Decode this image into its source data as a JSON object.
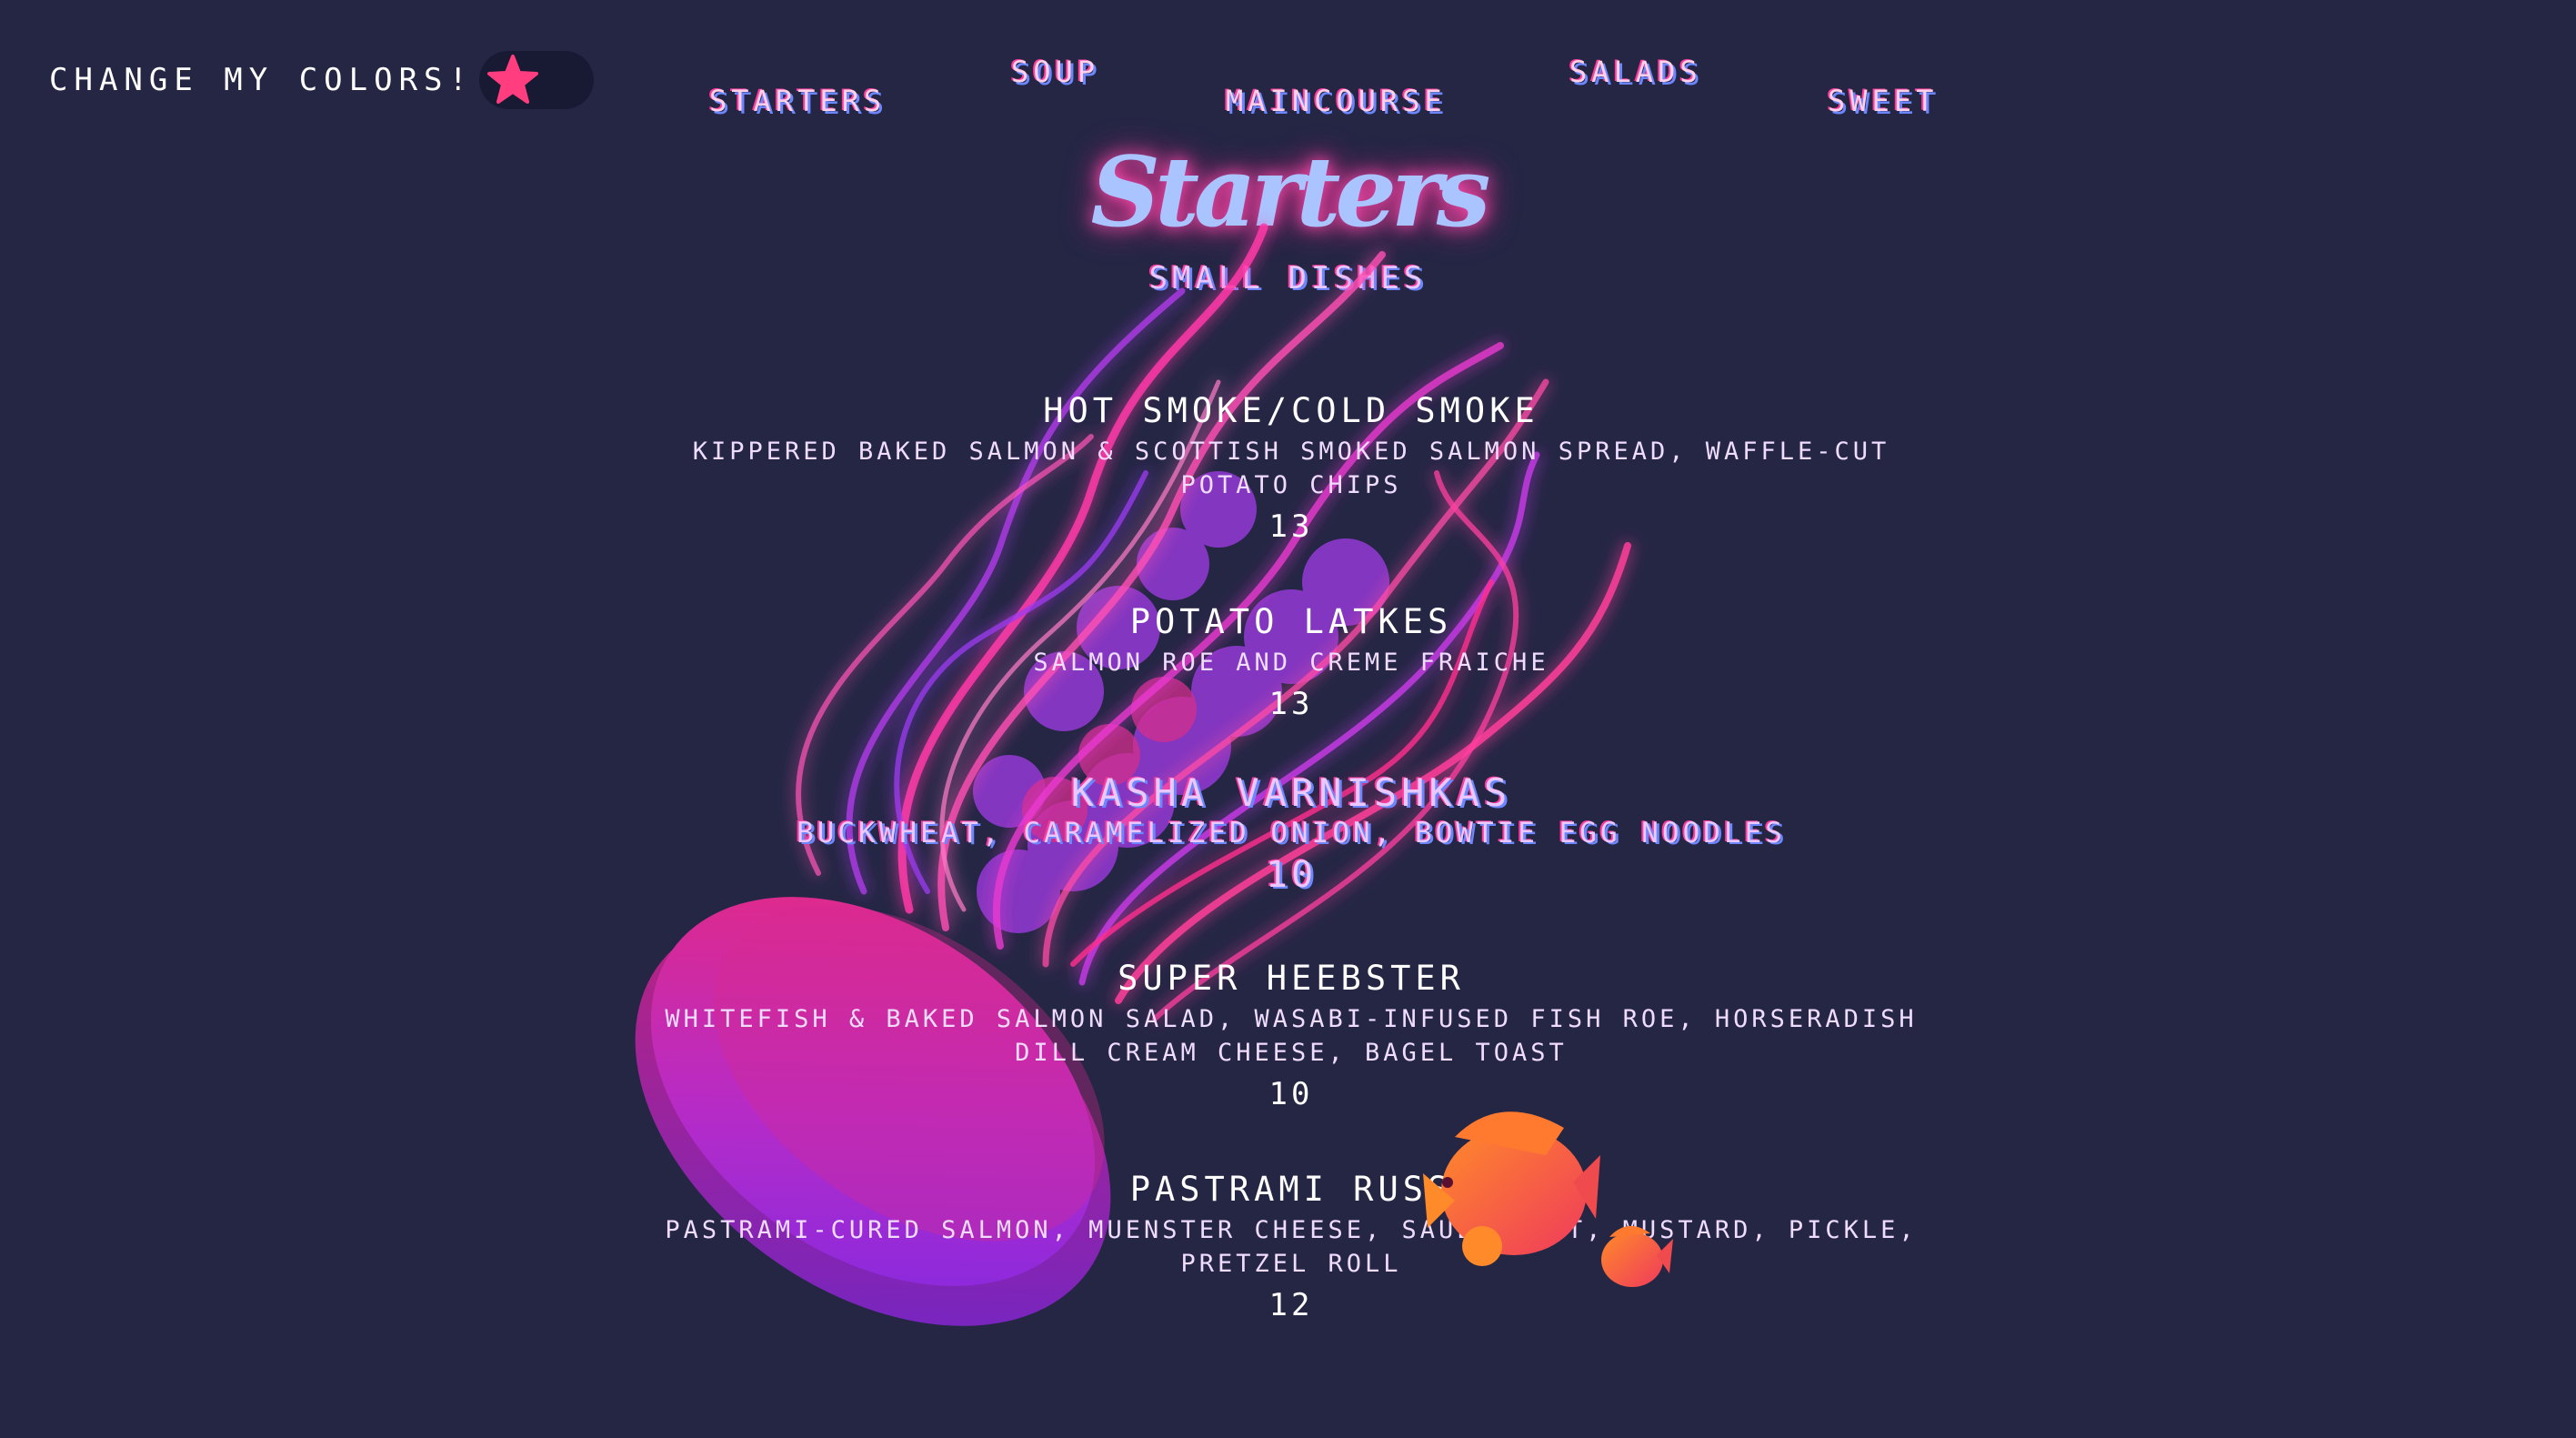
{
  "toggle": {
    "label": "Change my colors!",
    "icon": "starfish-icon",
    "knob_color": "#ff3d7f"
  },
  "nav": {
    "items": [
      {
        "label": "Starters"
      },
      {
        "label": "Soup"
      },
      {
        "label": "Maincourse"
      },
      {
        "label": "Salads"
      },
      {
        "label": "Sweet"
      }
    ]
  },
  "page": {
    "title": "Starters",
    "subtitle": "Small dishes"
  },
  "menu": {
    "items": [
      {
        "name": "Hot Smoke/Cold Smoke",
        "description": "Kippered baked salmon & Scottish smoked salmon spread, waffle-cut potato chips",
        "price": "13"
      },
      {
        "name": "Potato Latkes",
        "description": "Salmon roe and creme fraiche",
        "price": "13"
      },
      {
        "name": "Kasha Varnishkas",
        "description": "Buckwheat, caramelized onion, bowtie egg noodles",
        "price": "10"
      },
      {
        "name": "Super Heebster",
        "description": "Whitefish & baked salmon salad, wasabi-infused fish roe, horseradish dill cream cheese, bagel toast",
        "price": "10"
      },
      {
        "name": "Pastrami Russ",
        "description": "Pastrami-cured salmon, muenster cheese, sauerkraut, mustard, pickle, pretzel roll",
        "price": "12"
      }
    ]
  },
  "colors": {
    "background": "#242644",
    "accent_pink": "#ff3c9e",
    "accent_blue": "#6c86ff",
    "jellyfish_magenta": "#e4247f",
    "jellyfish_violet": "#8a2be2",
    "fish_orange": "#ff7a2f"
  }
}
